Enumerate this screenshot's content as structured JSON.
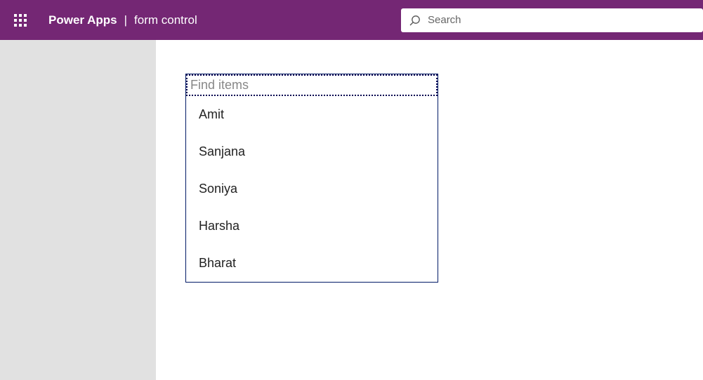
{
  "header": {
    "app_name": "Power Apps",
    "page_name": "form control",
    "search_placeholder": "Search"
  },
  "combo": {
    "placeholder": "Find items",
    "items": [
      {
        "label": "Amit"
      },
      {
        "label": "Sanjana"
      },
      {
        "label": "Soniya"
      },
      {
        "label": "Harsha"
      },
      {
        "label": "Bharat"
      }
    ]
  }
}
